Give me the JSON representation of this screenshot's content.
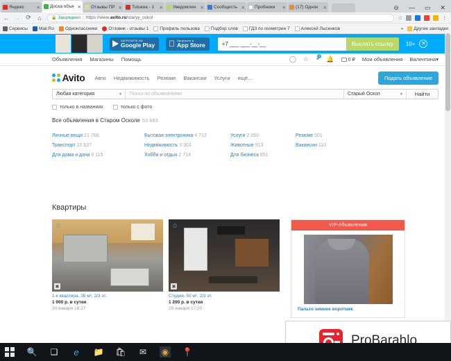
{
  "browser": {
    "tabs": [
      {
        "title": "Яндекс",
        "favicon": "#e02b23",
        "active": false
      },
      {
        "title": "Доска объя",
        "favicon": "#3bb44a",
        "active": true
      },
      {
        "title": "Отзывы ПР",
        "favicon": "#d9d9a0",
        "active": false
      },
      {
        "title": "Tutuкиа - 1",
        "favicon": "#e02b23",
        "active": false
      },
      {
        "title": "Уведомлен",
        "favicon": "#b7d86a",
        "active": false
      },
      {
        "title": "Сообщесть",
        "favicon": "#2a82d8",
        "active": false
      },
      {
        "title": "Пробники",
        "favicon": "#ffffff",
        "active": false
      },
      {
        "title": "(17) Однок",
        "favicon": "#f08a24",
        "active": false
      }
    ],
    "tab_close_label": "✕",
    "nav": {
      "back": "←",
      "forward": "→",
      "reload": "⟳",
      "home": "⌂"
    },
    "address": {
      "secure_label": "Защищено",
      "lock_icon": "🔒",
      "url_scheme": "https://www.",
      "url_domain": "avito.ru",
      "url_path": "/staryy_oskol",
      "star_icon": "☆",
      "menu_icon": "⋮"
    },
    "bookmarks": [
      {
        "label": "Сервисы",
        "color": "#5f6368"
      },
      {
        "label": "Mail.Ru",
        "color": "#1a5fb4"
      },
      {
        "label": "Одноклассники",
        "color": "#f08a24"
      },
      {
        "label": "Отзовик - отзывы 1",
        "color": "#e02b23"
      },
      {
        "label": "Профиль пользова",
        "color": "#ffffff"
      },
      {
        "label": "Подбор слов",
        "color": "#ffffff"
      },
      {
        "label": "ГДЗ по геометрии 7",
        "color": "#ffffff"
      },
      {
        "label": "Алексей Лысенков",
        "color": "#ffffff"
      }
    ],
    "bookmarks_overflow": "»",
    "other_bookmarks": "Другие закладки",
    "window_controls": {
      "profile": "⊖",
      "minimize": "—",
      "maximize": "▭",
      "close": "✕"
    }
  },
  "promo": {
    "google_play": {
      "small": "ЗАГРУЗИТЕ НА",
      "big": "Google Play"
    },
    "app_store": {
      "small": "Загрузите в",
      "big": "App Store"
    },
    "phone_value": "+7 ___ ___-__-__",
    "send_button": "Выслать ссылку",
    "age_label": "10+",
    "close_label": "✕"
  },
  "topnav": {
    "links": [
      "Объявления",
      "Магазины",
      "Помощь"
    ],
    "icons": [
      {
        "name": "messages-icon",
        "glyph": "◯"
      },
      {
        "name": "favorites-icon",
        "glyph": "☆"
      },
      {
        "name": "reviews-icon",
        "glyph": "◔",
        "badge": "4"
      },
      {
        "name": "notifications-icon",
        "glyph": "◠"
      }
    ],
    "wallet_value": "0 ₽",
    "my_ads": "Мои объявления",
    "user": "Валентина",
    "user_caret": "▾"
  },
  "header": {
    "logo_text": "Avito",
    "logo_dot_colors": [
      "#00aaff",
      "#97c93d",
      "#f2a900",
      "#00aaff"
    ],
    "nav": [
      "Авто",
      "Недвижимость",
      "Резюме",
      "Вакансии",
      "Услуги",
      "ещё..."
    ],
    "submit_button": "Подать объявление",
    "accent_color": "#2ba7de"
  },
  "search": {
    "category_value": "Любая категория",
    "placeholder": "Поиск по объявлениям",
    "input_value": "",
    "city_value": "Старый Оскол",
    "find_button": "Найти",
    "caret": "▾"
  },
  "filters": [
    {
      "label": "только в названиях",
      "checked": false
    },
    {
      "label": "только с фото",
      "checked": false
    }
  ],
  "all_ads": {
    "label": "Все объявления в Старом Осколе",
    "count": "53 683"
  },
  "categories": [
    {
      "label": "Личные вещи",
      "count": "21 766"
    },
    {
      "label": "Бытовая электроника",
      "count": "4 712"
    },
    {
      "label": "Услуги",
      "count": "2 060"
    },
    {
      "label": "Резюме",
      "count": "501"
    },
    {
      "label": "Транспорт",
      "count": "10 637"
    },
    {
      "label": "Недвижимость",
      "count": "3 303"
    },
    {
      "label": "Животные",
      "count": "913"
    },
    {
      "label": "Вакансии",
      "count": "110"
    },
    {
      "label": "Для дома и дачи",
      "count": "6 115"
    },
    {
      "label": "Хобби и отдых",
      "count": "2 714"
    },
    {
      "label": "Для бизнеса",
      "count": "851"
    },
    {
      "label": "",
      "count": ""
    }
  ],
  "section": {
    "title": "Квартиры",
    "cards": [
      {
        "title": "1-к квартира, 35 м², 2/3 эт.",
        "price": "1 000 р. в сутки",
        "date": "30 января 18:27",
        "fav_icon": "✩",
        "badge_icon": "▣"
      },
      {
        "title": "Студия, 50 м², 2/3 эт.",
        "price": "1 200 р. в сутки",
        "date": "29 января 17:20",
        "fav_icon": "✩",
        "badge_icon": "▣"
      }
    ]
  },
  "vip": {
    "header": "VIP-объявления",
    "header_color": "#f2594b",
    "item_title": "Пальто зимнее воротник",
    "fav_icon": "✩"
  },
  "watermark": {
    "text": "ProBarahlo",
    "logo_color": "#e8232a"
  },
  "taskbar": {
    "items": [
      {
        "name": "start-button",
        "glyph": "⊞"
      },
      {
        "name": "search-icon",
        "glyph": "🔍"
      },
      {
        "name": "task-view-icon",
        "glyph": "❐"
      },
      {
        "name": "edge-icon",
        "glyph": "e"
      },
      {
        "name": "file-explorer-icon",
        "glyph": "🗀"
      },
      {
        "name": "store-icon",
        "glyph": "🛍"
      },
      {
        "name": "mail-icon",
        "glyph": "✉"
      },
      {
        "name": "chrome-icon",
        "glyph": "◉"
      },
      {
        "name": "maps-icon",
        "glyph": "📍"
      }
    ]
  },
  "scrollbar": {
    "up": "▲",
    "down": "▼"
  }
}
